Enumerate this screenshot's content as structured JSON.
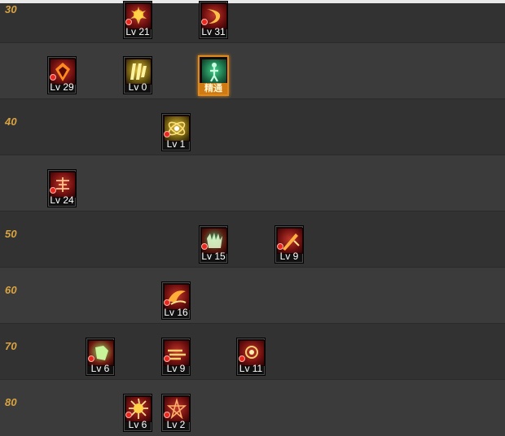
{
  "level_labels": [
    "30",
    "40",
    "50",
    "60",
    "70",
    "80"
  ],
  "skills": {
    "r30_a": {
      "icon": "flame-burst-icon",
      "level": "Lv 21"
    },
    "r30_b": {
      "icon": "crescent-slash-icon",
      "level": "Lv 31"
    },
    "r35_a": {
      "icon": "fire-shield-icon",
      "level": "Lv 29"
    },
    "r35_b": {
      "icon": "claw-strike-icon",
      "level": "Lv 0"
    },
    "r35_c": {
      "icon": "figure-aura-icon",
      "tag": "精通"
    },
    "r40_a": {
      "icon": "orbit-icon",
      "level": "Lv 1"
    },
    "r45_a": {
      "icon": "rune-icon",
      "level": "Lv 24"
    },
    "r50_a": {
      "icon": "claw-hand-icon",
      "level": "Lv 15"
    },
    "r50_b": {
      "icon": "blade-icon",
      "level": "Lv 9"
    },
    "r60_a": {
      "icon": "wing-slash-icon",
      "level": "Lv 16"
    },
    "r70_a": {
      "icon": "green-fist-icon",
      "level": "Lv 6"
    },
    "r70_b": {
      "icon": "dash-fire-icon",
      "level": "Lv 9"
    },
    "r70_c": {
      "icon": "sun-eye-icon",
      "level": "Lv 11"
    },
    "r80_a": {
      "icon": "explosion-icon",
      "level": "Lv 6"
    },
    "r80_b": {
      "icon": "pentagram-icon",
      "level": "Lv 2"
    }
  }
}
